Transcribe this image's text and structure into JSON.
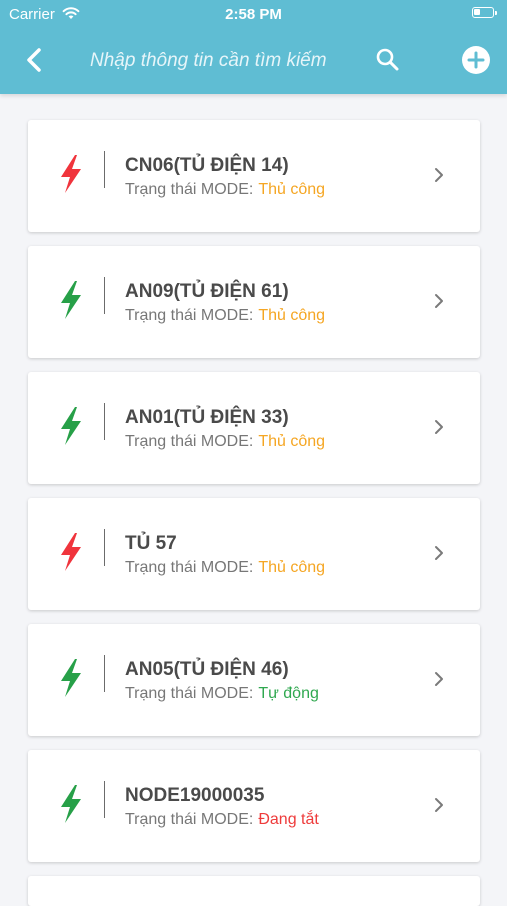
{
  "status_bar": {
    "carrier": "Carrier",
    "time": "2:58 PM"
  },
  "header": {
    "back_icon": "chevron-left-icon",
    "search_placeholder": "Nhập thông tin cần tìm kiếm",
    "search_icon": "search-icon",
    "add_icon": "plus-circle-icon"
  },
  "colors": {
    "header": "#5fbdd3",
    "bolt_red": "#f0343c",
    "bolt_green": "#27a048",
    "mode_manual": "#f5a623",
    "mode_auto": "#2fa84f",
    "mode_off": "#ee3b3b"
  },
  "mode_label": "Trạng thái MODE:",
  "devices": [
    {
      "name": "CN06(TỦ ĐIỆN 14)",
      "bolt_color": "red",
      "mode": "Thủ công",
      "mode_color": "#f5a623"
    },
    {
      "name": "AN09(TỦ ĐIỆN 61)",
      "bolt_color": "green",
      "mode": "Thủ công",
      "mode_color": "#f5a623"
    },
    {
      "name": "AN01(TỦ ĐIỆN 33)",
      "bolt_color": "green",
      "mode": "Thủ công",
      "mode_color": "#f5a623"
    },
    {
      "name": "TỦ 57",
      "bolt_color": "red",
      "mode": "Thủ công",
      "mode_color": "#f5a623"
    },
    {
      "name": "AN05(TỦ ĐIỆN 46)",
      "bolt_color": "green",
      "mode": "Tự động",
      "mode_color": "#2fa84f"
    },
    {
      "name": "NODE19000035",
      "bolt_color": "green",
      "mode": "Đang tắt",
      "mode_color": "#ee3b3b"
    }
  ]
}
